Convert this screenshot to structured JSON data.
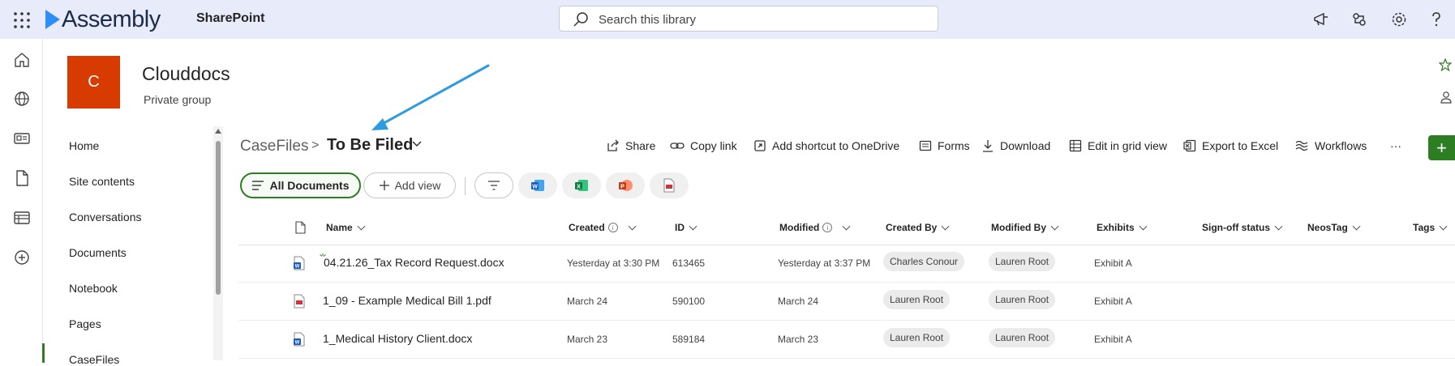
{
  "suite": {
    "brand": "Assembly",
    "app_name": "SharePoint",
    "search_placeholder": "Search this library"
  },
  "site": {
    "logo_letter": "C",
    "title": "Clouddocs",
    "subtitle": "Private group"
  },
  "nav": {
    "items": [
      {
        "label": "Home"
      },
      {
        "label": "Site contents"
      },
      {
        "label": "Conversations"
      },
      {
        "label": "Documents"
      },
      {
        "label": "Notebook"
      },
      {
        "label": "Pages"
      },
      {
        "label": "CaseFiles"
      }
    ]
  },
  "breadcrumb": {
    "parent": "CaseFiles",
    "separator": ">",
    "current": "To Be Filed"
  },
  "commands": {
    "share": "Share",
    "copy_link": "Copy link",
    "add_shortcut": "Add shortcut to OneDrive",
    "forms": "Forms",
    "download": "Download",
    "edit_grid": "Edit in grid view",
    "export_excel": "Export to Excel",
    "workflows": "Workflows",
    "more": "···",
    "new": "+"
  },
  "views": {
    "active": "All Documents",
    "add": "Add view"
  },
  "columns": {
    "name": "Name",
    "created": "Created",
    "id": "ID",
    "modified": "Modified",
    "created_by": "Created By",
    "modified_by": "Modified By",
    "exhibits": "Exhibits",
    "signoff": "Sign-off status",
    "neostag": "NeosTag",
    "tags": "Tags",
    "info_glyph": "i"
  },
  "rows": [
    {
      "name": "04.21.26_Tax Record Request.docx",
      "type": "word",
      "created": "Yesterday at 3:30 PM",
      "id": "613465",
      "modified": "Yesterday at 3:37 PM",
      "created_by": "Charles Conour",
      "modified_by": "Lauren Root",
      "exhibits": "Exhibit A"
    },
    {
      "name": "1_09 - Example Medical Bill 1.pdf",
      "type": "pdf",
      "created": "March 24",
      "id": "590100",
      "modified": "March 24",
      "created_by": "Lauren Root",
      "modified_by": "Lauren Root",
      "exhibits": "Exhibit A"
    },
    {
      "name": "1_Medical History Client.docx",
      "type": "word",
      "created": "March 23",
      "id": "589184",
      "modified": "March 23",
      "created_by": "Lauren Root",
      "modified_by": "Lauren Root",
      "exhibits": "Exhibit A"
    }
  ],
  "colors": {
    "suitebar": "#e8ebfa",
    "accent_green": "#2d7d23",
    "site_logo": "#d83b01",
    "brand_blue": "#2f8ef5",
    "annotation_arrow": "#2d9be0"
  },
  "icons": [
    "app-launcher-icon",
    "megaphone-icon",
    "feedback-icon",
    "settings-icon",
    "help-icon",
    "home-icon",
    "globe-icon",
    "news-icon",
    "file-icon",
    "lists-icon",
    "create-icon",
    "star-icon",
    "person-icon",
    "share-icon",
    "link-icon",
    "shortcut-icon",
    "forms-icon",
    "download-icon",
    "grid-icon",
    "excel-icon",
    "workflows-icon",
    "filter-icon",
    "word-icon",
    "powerpoint-icon",
    "pdf-icon"
  ]
}
